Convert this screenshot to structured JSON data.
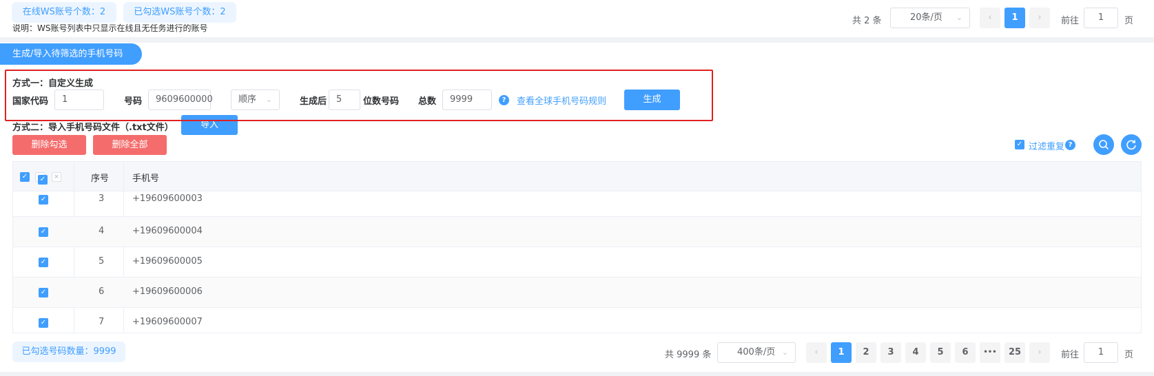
{
  "accounts": {
    "online_label": "在线WS账号个数：2",
    "selected_label": "已勾选WS账号个数：2",
    "note": "说明：WS账号列表中只显示在线且无任务进行的账号"
  },
  "top_pagination": {
    "total": "共 2 条",
    "page_size": "20条/页",
    "current_page": "1",
    "goto_label": "前往",
    "goto_value": "1",
    "page_suffix": "页"
  },
  "section_title": "生成/导入待筛选的手机号码",
  "method1": {
    "title": "方式一：自定义生成",
    "country_code_label": "国家代码",
    "country_code_value": "1",
    "number_label": "号码",
    "number_value": "9609600000",
    "order_select": "顺序",
    "after_label": "生成后",
    "digits_value": "5",
    "digits_suffix": "位数号码",
    "total_label": "总数",
    "total_value": "9999",
    "rules_link": "查看全球手机号码规则",
    "generate_button": "生成"
  },
  "method2": {
    "title": "方式二：导入手机号码文件（.txt文件）",
    "import_button": "导入"
  },
  "actions": {
    "delete_selected": "删除勾选",
    "delete_all": "删除全部",
    "filter_duplicates": "过滤重复"
  },
  "table": {
    "headers": {
      "index": "序号",
      "phone": "手机号"
    },
    "rows": [
      {
        "index": "3",
        "phone": "+19609600003"
      },
      {
        "index": "4",
        "phone": "+19609600004"
      },
      {
        "index": "5",
        "phone": "+19609600005"
      },
      {
        "index": "6",
        "phone": "+19609600006"
      },
      {
        "index": "7",
        "phone": "+19609600007"
      }
    ]
  },
  "selected_count_label": "已勾选号码数量：9999",
  "bottom_pagination": {
    "total": "共 9999 条",
    "page_size": "400条/页",
    "pages": [
      "1",
      "2",
      "3",
      "4",
      "5",
      "6"
    ],
    "ellipsis": "•••",
    "last_page": "25",
    "current_page": "1",
    "goto_label": "前往",
    "goto_value": "1",
    "page_suffix": "页"
  },
  "icons": {
    "prev": "chevron-left-icon",
    "next": "chevron-right-icon",
    "select": "chevron-down-icon",
    "help": "question-circle-icon",
    "search": "search-icon",
    "refresh": "refresh-icon",
    "checkbox": "checkbox-checked-icon"
  },
  "colors": {
    "primary": "#409eff",
    "danger": "#f56c6c",
    "highlight_border": "#e02020",
    "tag_bg": "#ecf5ff"
  }
}
